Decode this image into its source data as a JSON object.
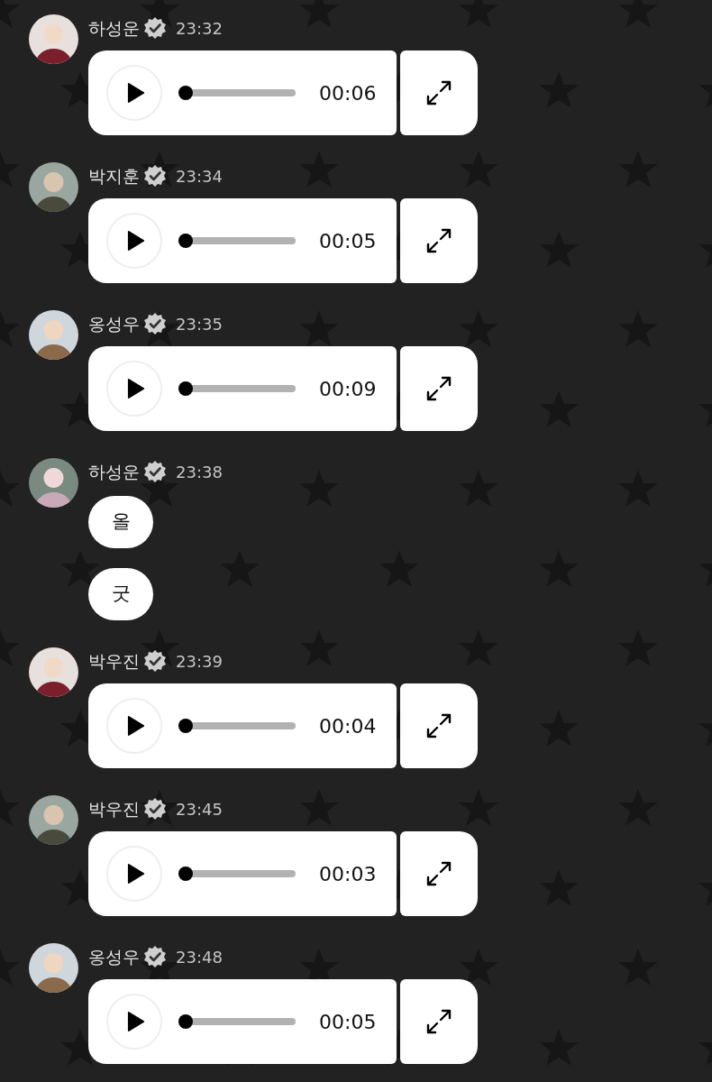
{
  "messages": [
    {
      "author": "하성운",
      "verified": true,
      "time": "23:32",
      "kind": "audio",
      "level": 0,
      "duration": "00:06"
    },
    {
      "author": "박지훈",
      "verified": true,
      "time": "23:34",
      "kind": "audio",
      "level": 0,
      "duration": "00:05"
    },
    {
      "author": "옹성우",
      "verified": true,
      "time": "23:35",
      "kind": "audio",
      "level": 0,
      "duration": "00:09"
    },
    {
      "author": "하성운",
      "verified": true,
      "time": "23:38",
      "kind": "text",
      "bubbles": [
        "올",
        "굿"
      ]
    },
    {
      "author": "박우진",
      "verified": true,
      "time": "23:39",
      "kind": "audio",
      "level": 0,
      "duration": "00:04"
    },
    {
      "author": "박우진",
      "verified": true,
      "time": "23:45",
      "kind": "audio",
      "level": 0,
      "duration": "00:03"
    },
    {
      "author": "옹성우",
      "verified": true,
      "time": "23:48",
      "kind": "audio",
      "level": 0,
      "duration": "00:05"
    }
  ]
}
